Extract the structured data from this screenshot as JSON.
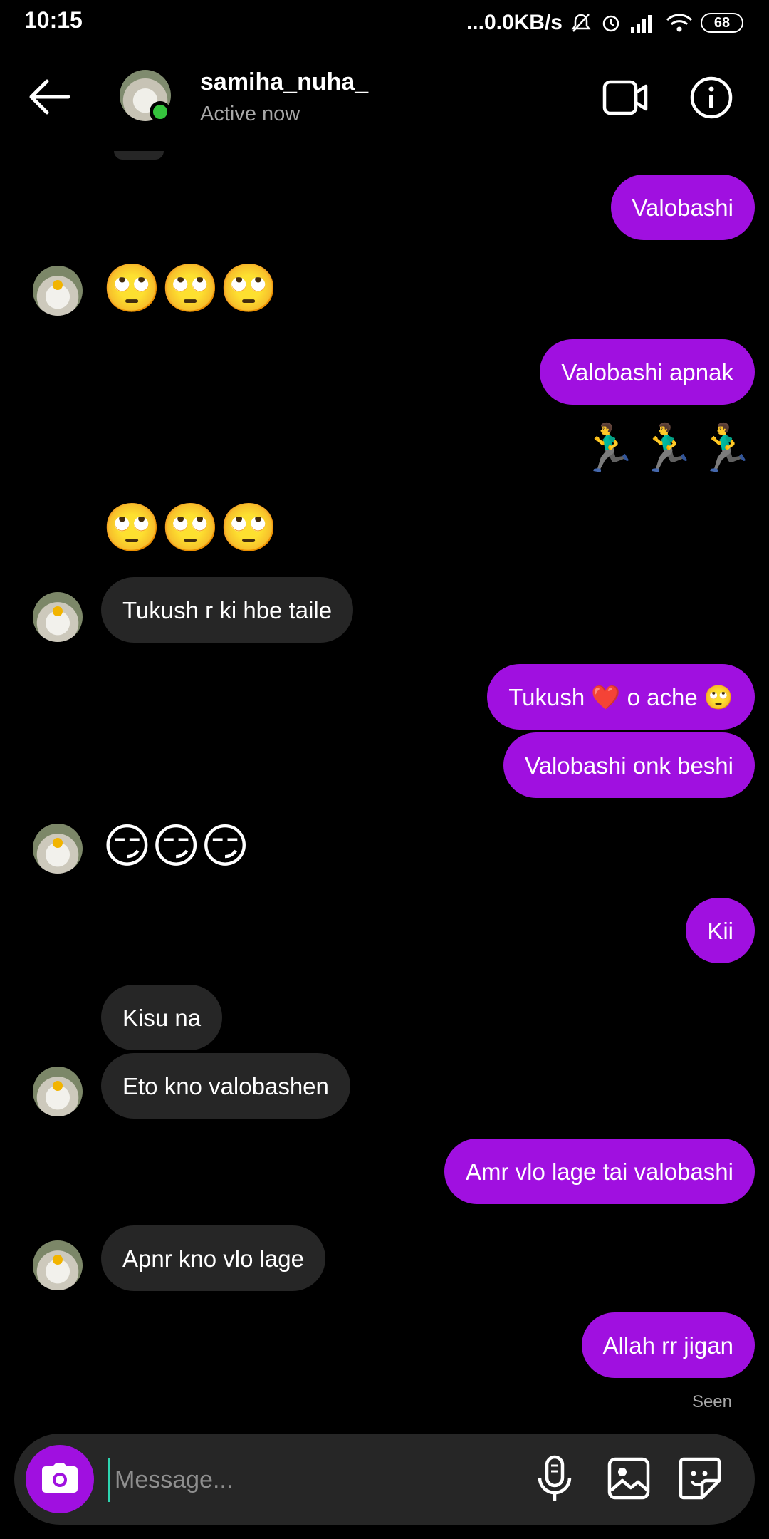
{
  "status_bar": {
    "time": "10:15",
    "network_speed": "...0.0KB/s",
    "battery": "68"
  },
  "header": {
    "username": "samiha_nuha_",
    "status": "Active now"
  },
  "messages": [
    {
      "type": "text",
      "from": "me",
      "text": "Valobashi"
    },
    {
      "type": "emoji",
      "from": "them",
      "text": "🙄🙄🙄"
    },
    {
      "type": "text",
      "from": "me",
      "text": "Valobashi apnak"
    },
    {
      "type": "emoji",
      "from": "me",
      "text": "🏃‍♂️🏃‍♂️🏃‍♂️"
    },
    {
      "type": "emoji",
      "from": "them",
      "text": "🙄🙄🙄"
    },
    {
      "type": "text",
      "from": "them",
      "text": "Tukush r ki hbe taile"
    },
    {
      "type": "text",
      "from": "me",
      "text": "Tukush ❤️ o ache 🙄"
    },
    {
      "type": "text",
      "from": "me",
      "text": "Valobashi onk beshi"
    },
    {
      "type": "emoji",
      "from": "them",
      "text": "😏😏😏"
    },
    {
      "type": "text",
      "from": "me",
      "text": "Kii"
    },
    {
      "type": "text",
      "from": "them",
      "text": "Kisu na"
    },
    {
      "type": "text",
      "from": "them",
      "text": "Eto kno valobashen"
    },
    {
      "type": "text",
      "from": "me",
      "text": "Amr vlo lage tai valobashi"
    },
    {
      "type": "text",
      "from": "them",
      "text": "Apnr kno vlo lage"
    },
    {
      "type": "text",
      "from": "me",
      "text": "Allah rr jigan"
    }
  ],
  "seen_label": "Seen",
  "composer": {
    "placeholder": "Message..."
  },
  "colors": {
    "sent_bubble": "#a010e0",
    "received_bubble": "#262626",
    "online": "#35c43d"
  }
}
